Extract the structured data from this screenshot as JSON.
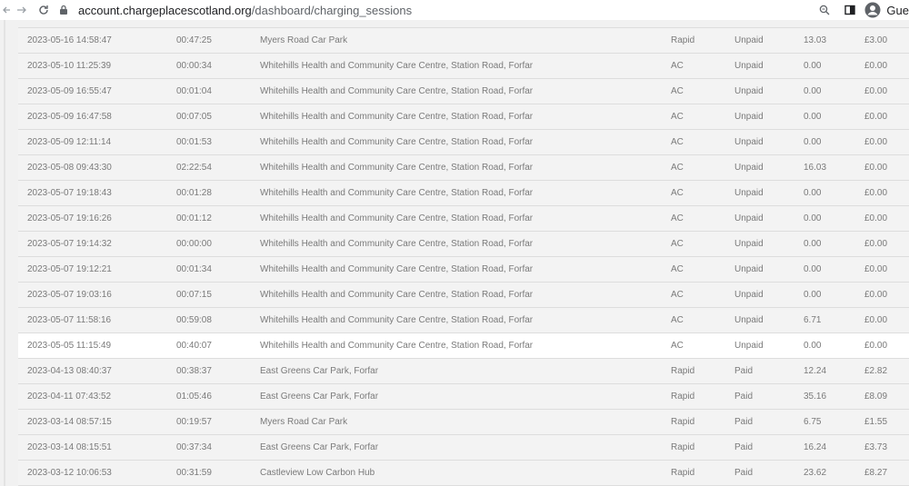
{
  "browser": {
    "url_host": "account.chargeplacescotland.org",
    "url_path": "/dashboard/charging_sessions",
    "profile_label": "Gue"
  },
  "sessions": [
    {
      "date": "2023-05-16 14:58:47",
      "duration": "00:47:25",
      "location": "Myers Road Car Park",
      "type": "Rapid",
      "status": "Unpaid",
      "kwh": "13.03",
      "cost": "£3.00"
    },
    {
      "date": "2023-05-10 11:25:39",
      "duration": "00:00:34",
      "location": "Whitehills Health and Community Care Centre, Station Road, Forfar",
      "type": "AC",
      "status": "Unpaid",
      "kwh": "0.00",
      "cost": "£0.00"
    },
    {
      "date": "2023-05-09 16:55:47",
      "duration": "00:01:04",
      "location": "Whitehills Health and Community Care Centre, Station Road, Forfar",
      "type": "AC",
      "status": "Unpaid",
      "kwh": "0.00",
      "cost": "£0.00"
    },
    {
      "date": "2023-05-09 16:47:58",
      "duration": "00:07:05",
      "location": "Whitehills Health and Community Care Centre, Station Road, Forfar",
      "type": "AC",
      "status": "Unpaid",
      "kwh": "0.00",
      "cost": "£0.00"
    },
    {
      "date": "2023-05-09 12:11:14",
      "duration": "00:01:53",
      "location": "Whitehills Health and Community Care Centre, Station Road, Forfar",
      "type": "AC",
      "status": "Unpaid",
      "kwh": "0.00",
      "cost": "£0.00"
    },
    {
      "date": "2023-05-08 09:43:30",
      "duration": "02:22:54",
      "location": "Whitehills Health and Community Care Centre, Station Road, Forfar",
      "type": "AC",
      "status": "Unpaid",
      "kwh": "16.03",
      "cost": "£0.00"
    },
    {
      "date": "2023-05-07 19:18:43",
      "duration": "00:01:28",
      "location": "Whitehills Health and Community Care Centre, Station Road, Forfar",
      "type": "AC",
      "status": "Unpaid",
      "kwh": "0.00",
      "cost": "£0.00"
    },
    {
      "date": "2023-05-07 19:16:26",
      "duration": "00:01:12",
      "location": "Whitehills Health and Community Care Centre, Station Road, Forfar",
      "type": "AC",
      "status": "Unpaid",
      "kwh": "0.00",
      "cost": "£0.00"
    },
    {
      "date": "2023-05-07 19:14:32",
      "duration": "00:00:00",
      "location": "Whitehills Health and Community Care Centre, Station Road, Forfar",
      "type": "AC",
      "status": "Unpaid",
      "kwh": "0.00",
      "cost": "£0.00"
    },
    {
      "date": "2023-05-07 19:12:21",
      "duration": "00:01:34",
      "location": "Whitehills Health and Community Care Centre, Station Road, Forfar",
      "type": "AC",
      "status": "Unpaid",
      "kwh": "0.00",
      "cost": "£0.00"
    },
    {
      "date": "2023-05-07 19:03:16",
      "duration": "00:07:15",
      "location": "Whitehills Health and Community Care Centre, Station Road, Forfar",
      "type": "AC",
      "status": "Unpaid",
      "kwh": "0.00",
      "cost": "£0.00"
    },
    {
      "date": "2023-05-07 11:58:16",
      "duration": "00:59:08",
      "location": "Whitehills Health and Community Care Centre, Station Road, Forfar",
      "type": "AC",
      "status": "Unpaid",
      "kwh": "6.71",
      "cost": "£0.00"
    },
    {
      "date": "2023-05-05 11:15:49",
      "duration": "00:40:07",
      "location": "Whitehills Health and Community Care Centre, Station Road, Forfar",
      "type": "AC",
      "status": "Unpaid",
      "kwh": "0.00",
      "cost": "£0.00",
      "highlight": true
    },
    {
      "date": "2023-04-13 08:40:37",
      "duration": "00:38:37",
      "location": "East Greens Car Park, Forfar",
      "type": "Rapid",
      "status": "Paid",
      "kwh": "12.24",
      "cost": "£2.82"
    },
    {
      "date": "2023-04-11 07:43:52",
      "duration": "01:05:46",
      "location": "East Greens Car Park, Forfar",
      "type": "Rapid",
      "status": "Paid",
      "kwh": "35.16",
      "cost": "£8.09"
    },
    {
      "date": "2023-03-14 08:57:15",
      "duration": "00:19:57",
      "location": "Myers Road Car Park",
      "type": "Rapid",
      "status": "Paid",
      "kwh": "6.75",
      "cost": "£1.55"
    },
    {
      "date": "2023-03-14 08:15:51",
      "duration": "00:37:34",
      "location": "East Greens Car Park, Forfar",
      "type": "Rapid",
      "status": "Paid",
      "kwh": "16.24",
      "cost": "£3.73"
    },
    {
      "date": "2023-03-12 10:06:53",
      "duration": "00:31:59",
      "location": "Castleview Low Carbon Hub",
      "type": "Rapid",
      "status": "Paid",
      "kwh": "23.62",
      "cost": "£8.27"
    }
  ]
}
